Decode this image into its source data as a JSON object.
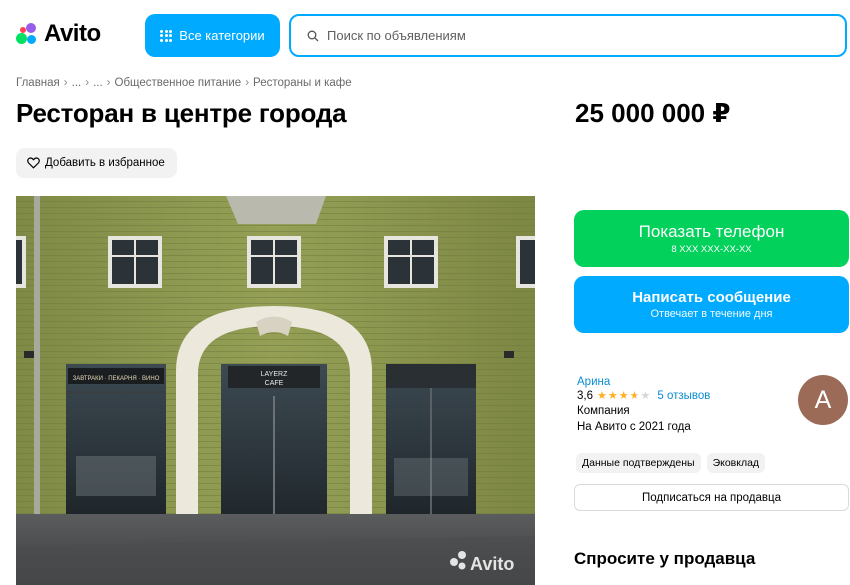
{
  "header": {
    "logo_text": "Avito",
    "categories_button": "Все категории",
    "search_placeholder": "Поиск по объявлениям"
  },
  "breadcrumb": [
    "Главная",
    "...",
    "...",
    "Общественное питание",
    "Рестораны и кафе"
  ],
  "listing": {
    "title": "Ресторан в центре города",
    "price": "25 000 000 ₽",
    "favorite_label": "Добавить в избранное"
  },
  "photo": {
    "sign_text_left": "ЗАВТРАКИ · ПЕКАРНЯ · ВИНО",
    "cafe_sign_line1": "LAYERZ",
    "cafe_sign_line2": "CAFE",
    "watermark": "Avito"
  },
  "contact": {
    "phone_button": "Показать телефон",
    "phone_masked": "8 XXX XXX-XX-XX",
    "message_button": "Написать сообщение",
    "message_sub": "Отвечает в течение дня"
  },
  "seller": {
    "name": "Арина",
    "rating": "3,6",
    "reviews": "5 отзывов",
    "type": "Компания",
    "since": "На Авито с 2021 года",
    "avatar_letter": "A",
    "tags": [
      "Данные подтверждены",
      "Эковклад"
    ],
    "subscribe_button": "Подписаться на продавца"
  },
  "ask_heading": "Спросите у продавца",
  "colors": {
    "accent_blue": "#00aaff",
    "call_green": "#02d15c",
    "star": "#ffb021",
    "avatar_bg": "#9b6b57"
  }
}
